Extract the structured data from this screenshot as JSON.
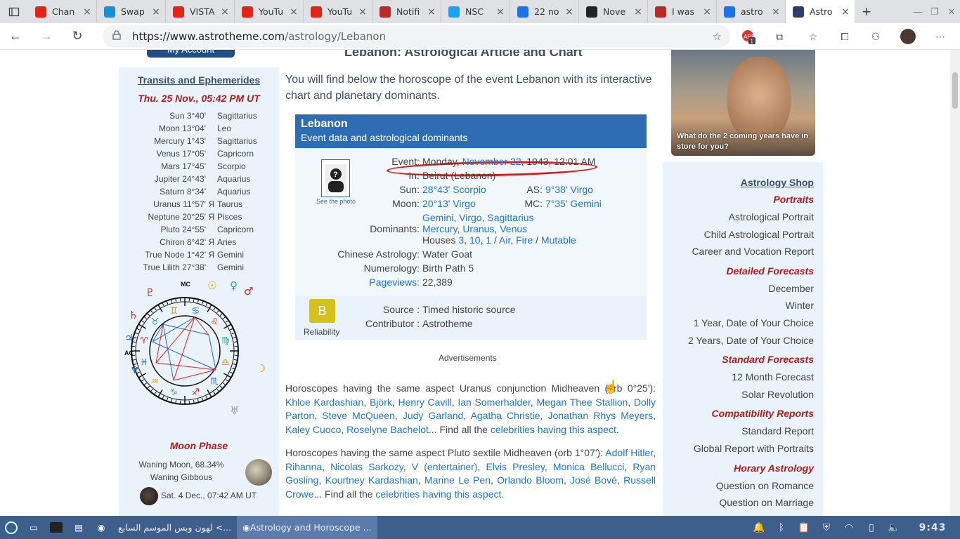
{
  "browser": {
    "tabs": [
      {
        "title": "Chan",
        "favicon": "youtube-icon",
        "color": "#e62117"
      },
      {
        "title": "Swap",
        "favicon": "swap-icon",
        "color": "#1a8fd6"
      },
      {
        "title": "VISTA",
        "favicon": "youtube-icon",
        "color": "#e62117"
      },
      {
        "title": "YouTu",
        "favicon": "youtube-icon",
        "color": "#e62117"
      },
      {
        "title": "YouTu",
        "favicon": "youtube-icon",
        "color": "#e62117"
      },
      {
        "title": "Notifi",
        "favicon": "quora-icon",
        "color": "#b92b27"
      },
      {
        "title": "NSC",
        "favicon": "twitter-icon",
        "color": "#1da1f2"
      },
      {
        "title": "22 no",
        "favicon": "bing-icon",
        "color": "#1a73e8"
      },
      {
        "title": "Nove",
        "favicon": "tep-icon",
        "color": "#222222"
      },
      {
        "title": "I was",
        "favicon": "quora-icon",
        "color": "#b92b27"
      },
      {
        "title": "astro",
        "favicon": "bing-icon",
        "color": "#1a73e8"
      },
      {
        "title": "Astro",
        "favicon": "astrotheme-icon",
        "color": "#2a3e6c"
      }
    ],
    "url_prefix": "https://www.astrotheme.com",
    "url_path": "/astrology/Lebanon",
    "ext_badge": "1"
  },
  "page": {
    "my_account": "My Account",
    "title": "Lebanon: Astrological Article and Chart",
    "intro": "You will find below the horoscope of the event Lebanon with its interactive chart and planetary dominants."
  },
  "transits": {
    "heading": "Transits and Ephemerides",
    "date": "Thu. 25 Nov., 05:42 PM UT",
    "rows": [
      {
        "planet": "Sun",
        "pos": "3°40'",
        "retro": "",
        "sign": "Sagittarius"
      },
      {
        "planet": "Moon",
        "pos": "13°04'",
        "retro": "",
        "sign": "Leo"
      },
      {
        "planet": "Mercury",
        "pos": "1°43'",
        "retro": "",
        "sign": "Sagittarius"
      },
      {
        "planet": "Venus",
        "pos": "17°05'",
        "retro": "",
        "sign": "Capricorn"
      },
      {
        "planet": "Mars",
        "pos": "17°45'",
        "retro": "",
        "sign": "Scorpio"
      },
      {
        "planet": "Jupiter",
        "pos": "24°43'",
        "retro": "",
        "sign": "Aquarius"
      },
      {
        "planet": "Saturn",
        "pos": "8°34'",
        "retro": "",
        "sign": "Aquarius"
      },
      {
        "planet": "Uranus",
        "pos": "11°57'",
        "retro": "Я",
        "sign": "Taurus"
      },
      {
        "planet": "Neptune",
        "pos": "20°25'",
        "retro": "Я",
        "sign": "Pisces"
      },
      {
        "planet": "Pluto",
        "pos": "24°55'",
        "retro": "",
        "sign": "Capricorn"
      },
      {
        "planet": "Chiron",
        "pos": "8°42'",
        "retro": "Я",
        "sign": "Aries"
      },
      {
        "planet": "True Node",
        "pos": "1°42'",
        "retro": "Я",
        "sign": "Gemini"
      },
      {
        "planet": "True Lilith",
        "pos": "27°38'",
        "retro": "",
        "sign": "Gemini"
      }
    ],
    "wheel_labels": {
      "mc": "MC",
      "ac": "AC"
    },
    "moon_phase_heading": "Moon Phase",
    "moon_phase_text": "Waning Moon, 68.34% Waning Gibbous",
    "next_new_moon": "Sat. 4 Dec., 07:42 AM UT"
  },
  "event": {
    "name": "Lebanon",
    "subtitle": "Event data and astrological dominants",
    "see_photo": "See the photo",
    "event_label": "Event:",
    "event_day": "Monday,",
    "event_date_link": "November 22",
    "event_rest": ", 1943, 12:01 AM",
    "in_label": "In:",
    "in_value": "Beirut (Lebanon)",
    "sun_label": "Sun:",
    "sun_value": "28°43' Scorpio",
    "as_label": "AS:",
    "as_value": "9°38' Virgo",
    "moon_label": "Moon:",
    "moon_value": "20°13' Virgo",
    "mc_label": "MC:",
    "mc_value": "7°35' Gemini",
    "dominants_label": "Dominants:",
    "dom_signs": [
      "Gemini",
      "Virgo",
      "Sagittarius"
    ],
    "dom_planets": [
      "Mercury",
      "Uranus",
      "Venus"
    ],
    "houses_label": "Houses",
    "houses": [
      "3",
      "10",
      "1"
    ],
    "elements": [
      "Air",
      "Fire"
    ],
    "modality": "Mutable",
    "chinese_label": "Chinese Astrology:",
    "chinese_value": "Water Goat",
    "numerology_label": "Numerology:",
    "numerology_value": "Birth Path 5",
    "pageviews_label": "Pageviews:",
    "pageviews_value": "22,389",
    "reliability_letter": "B",
    "reliability_label": "Reliability",
    "source_label": "Source :",
    "source_value": "Timed historic source",
    "contributor_label": "Contributor :",
    "contributor_value": "Astrotheme"
  },
  "ads_label": "Advertisements",
  "aspects": [
    {
      "intro": "Horoscopes having the same aspect Uranus conjunction Midheaven (orb 0°25'): ",
      "names": [
        "Khloe Kardashian",
        "Björk",
        "Henry Cavill",
        "Ian Somerhalder",
        "Megan Thee Stallion",
        "Dolly Parton",
        "Steve McQueen",
        "Judy Garland",
        "Agatha Christie",
        "Jonathan Rhys Meyers",
        "Kaley Cuoco",
        "Roselyne Bachelot"
      ],
      "tail": "... Find all the ",
      "link": "celebrities having this aspect",
      "end": "."
    },
    {
      "intro": "Horoscopes having the same aspect Pluto sextile Midheaven (orb 1°07'): ",
      "names": [
        "Adolf Hitler",
        "Rihanna",
        "Nicolas Sarkozy",
        "V (entertainer)",
        "Elvis Presley",
        "Monica Bellucci",
        "Ryan Gosling",
        "Kourtney Kardashian",
        "Marine Le Pen",
        "Orlando Bloom",
        "José Bové",
        "Russell Crowe"
      ],
      "tail": "... Find all the ",
      "link": "celebrities having this aspect",
      "end": "."
    }
  ],
  "ad_banner": {
    "caption": "What do the 2 coming years have in store for you?"
  },
  "shop": {
    "heading": "Astrology Shop",
    "sections": [
      {
        "title": "Portraits",
        "items": [
          "Astrological Portrait",
          "Child Astrological Portrait",
          "Career and Vocation Report"
        ]
      },
      {
        "title": "Detailed Forecasts",
        "items": [
          "December",
          "Winter",
          "1 Year, Date of Your Choice",
          "2 Years, Date of Your Choice"
        ]
      },
      {
        "title": "Standard Forecasts",
        "items": [
          "12 Month Forecast",
          "Solar Revolution"
        ]
      },
      {
        "title": "Compatibility Reports",
        "items": [
          "Standard Report",
          "Global Report with Portraits"
        ]
      },
      {
        "title": "Horary Astrology",
        "items": [
          "Question on Romance",
          "Question on Marriage"
        ]
      }
    ]
  },
  "taskbar": {
    "windows": [
      {
        "title": "لهون وبس الموسم السابع <...",
        "active": false
      },
      {
        "title": "Astrology and Horoscope ...",
        "active": true
      }
    ],
    "clock": "9:43"
  }
}
